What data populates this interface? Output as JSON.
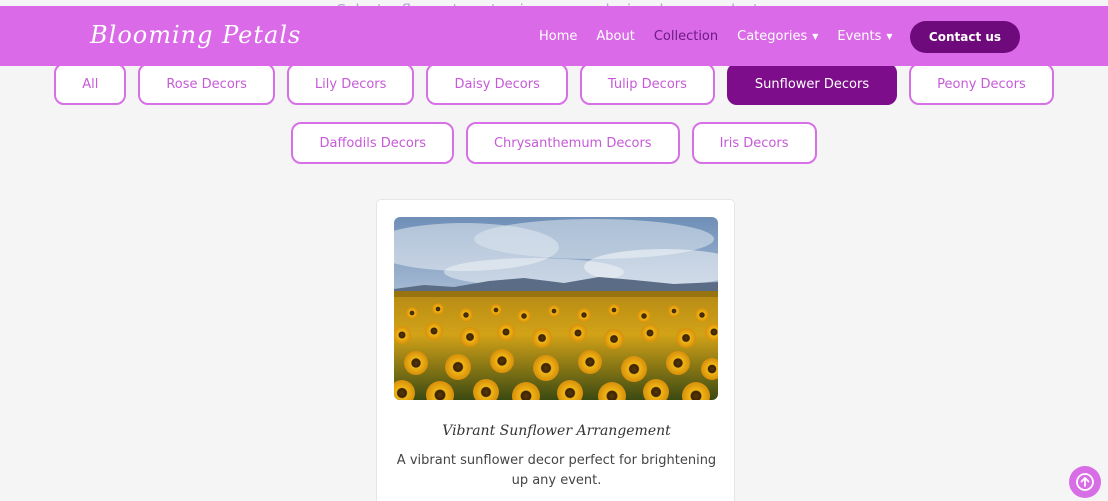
{
  "intro": {
    "text": "Select a flower type to view our exclusive decor products."
  },
  "header": {
    "logo": "Blooming Petals",
    "nav": [
      {
        "label": "Home"
      },
      {
        "label": "About"
      },
      {
        "label": "Collection",
        "active": true
      },
      {
        "label": "Categories",
        "dropdown": true
      },
      {
        "label": "Events",
        "dropdown": true
      }
    ],
    "contact_label": "Contact us"
  },
  "filters": {
    "row1": [
      "All",
      "Rose Decors",
      "Lily Decors",
      "Daisy Decors",
      "Tulip Decors",
      "Sunflower Decors",
      "Peony Decors"
    ],
    "row2": [
      "Daffodils Decors",
      "Chrysanthemum Decors",
      "Iris Decors"
    ],
    "active": "Sunflower Decors"
  },
  "product": {
    "title": "Vibrant Sunflower Arrangement",
    "description": "A vibrant sunflower decor perfect for brightening up any event."
  },
  "icons": {
    "chevron": "chevron-down-icon",
    "scroll_top": "arrow-up-circle-icon"
  },
  "colors": {
    "header_bg": "#da6ae8",
    "accent_dark": "#7e0d8c",
    "pill_border": "#d770e6",
    "pill_text": "#c65ad8"
  }
}
